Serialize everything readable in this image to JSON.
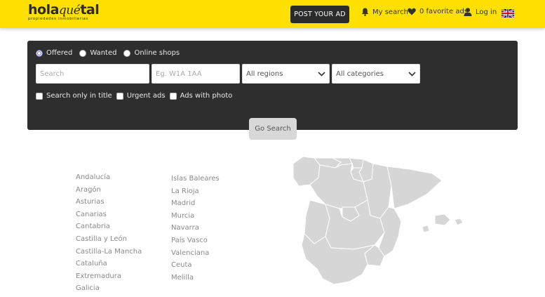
{
  "header": {
    "logo_main_a": "hola",
    "logo_main_b": "qué",
    "logo_main_c": "tal",
    "logo_sub": "propiedades   inmobiliarias",
    "post_button": "POST YOUR AD",
    "my_search": "My search",
    "favorites": "0 favorite ads",
    "login": "Log in",
    "language_flag": "uk-flag-icon"
  },
  "search": {
    "ad_types": [
      {
        "label": "Offered",
        "checked": true
      },
      {
        "label": "Wanted",
        "checked": false
      },
      {
        "label": "Online shops",
        "checked": false
      }
    ],
    "query_placeholder": "Search",
    "postcode_placeholder": "Eg. W1A 1AA",
    "region_selected": "All regions",
    "category_selected": "All categories",
    "filters": [
      {
        "label": "Search only in title",
        "checked": false
      },
      {
        "label": "Urgent ads",
        "checked": false
      },
      {
        "label": "Ads with photo",
        "checked": false
      }
    ],
    "go_button": "Go Search"
  },
  "regions": {
    "column1": [
      "Andalucía",
      "Aragón",
      "Asturias",
      "Canarias",
      "Cantabria",
      "Castilla y León",
      "Castilla-La Mancha",
      "Cataluña",
      "Extremadura",
      "Galicia"
    ],
    "column2": [
      "Islas Baleares",
      "La Rioja",
      "Madrid",
      "Murcia",
      "Navarra",
      "País Vasco",
      "Valenciana",
      "Ceuta",
      "Melilla"
    ]
  },
  "colors": {
    "header_bg": "#ffe000",
    "panel_bg": "#2e2e2e",
    "map_fill": "#d6d6d6"
  }
}
